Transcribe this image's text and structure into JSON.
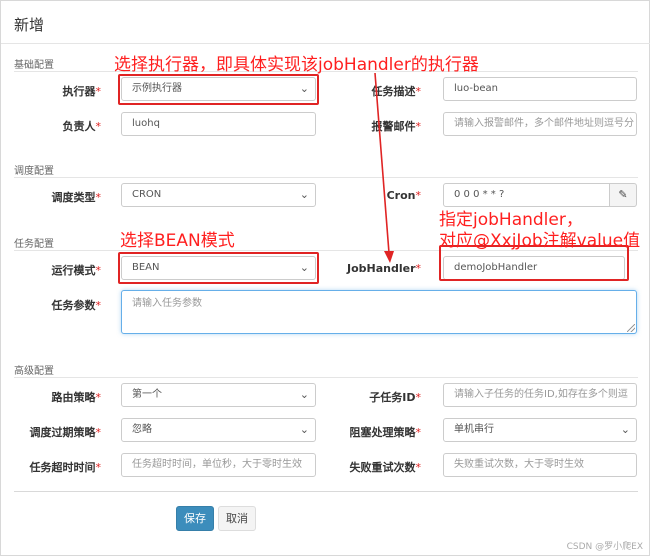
{
  "dialog": {
    "title": "新增"
  },
  "sections": {
    "basic": "基础配置",
    "schedule": "调度配置",
    "task": "任务配置",
    "advanced": "高级配置"
  },
  "fields": {
    "executor": {
      "label": "执行器",
      "value": "示例执行器"
    },
    "job_desc": {
      "label": "任务描述",
      "value": "luo-bean"
    },
    "author": {
      "label": "负责人",
      "value": "luohq"
    },
    "alarm_email": {
      "label": "报警邮件",
      "placeholder": "请输入报警邮件，多个邮件地址则逗号分"
    },
    "schedule_type": {
      "label": "调度类型",
      "value": "CRON"
    },
    "cron": {
      "label": "Cron",
      "value": "0 0 0 * * ?"
    },
    "glue_type": {
      "label": "运行模式",
      "value": "BEAN"
    },
    "job_handler": {
      "label": "JobHandler",
      "value": "demoJobHandler"
    },
    "job_param": {
      "label": "任务参数",
      "placeholder": "请输入任务参数"
    },
    "route_strategy": {
      "label": "路由策略",
      "value": "第一个"
    },
    "child_job_id": {
      "label": "子任务ID",
      "placeholder": "请输入子任务的任务ID,如存在多个则逗"
    },
    "misfire_strategy": {
      "label": "调度过期策略",
      "value": "忽略"
    },
    "block_strategy": {
      "label": "阻塞处理策略",
      "value": "单机串行"
    },
    "timeout": {
      "label": "任务超时时间",
      "placeholder": "任务超时时间，单位秒，大于零时生效"
    },
    "fail_retry": {
      "label": "失败重试次数",
      "placeholder": "失败重试次数，大于零时生效"
    }
  },
  "required_mark": "*",
  "annotations": {
    "executor_note": "选择执行器，即具体实现该jobHandler的执行器",
    "bean_note": "选择BEAN模式",
    "handler_note_line1": "指定jobHandler，",
    "handler_note_line2": "对应@XxjJob注解value值"
  },
  "buttons": {
    "save": "保存",
    "cancel": "取消"
  },
  "icons": {
    "select_arrow": "chevron-down-icon",
    "cron_edit": "edit-icon"
  },
  "watermark": "CSDN @罗小爬EX",
  "colors": {
    "annotation_red": "#ff1f1f",
    "primary": "#3c8dbc"
  }
}
